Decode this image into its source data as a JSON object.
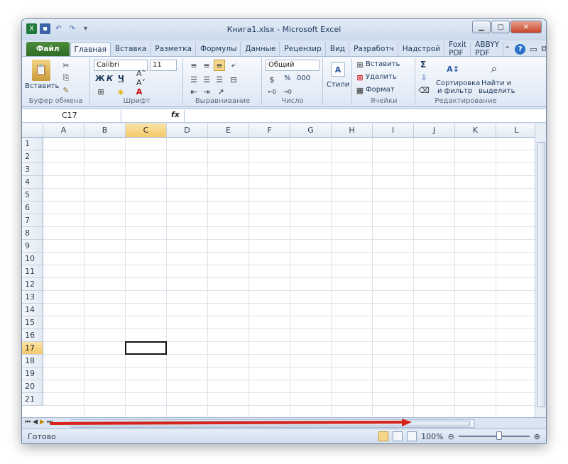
{
  "window": {
    "title": "Книга1.xlsx - Microsoft Excel"
  },
  "tabs": [
    "Файл",
    "Главная",
    "Вставка",
    "Разметка",
    "Формулы",
    "Данные",
    "Рецензир",
    "Вид",
    "Разработч",
    "Надстрой",
    "Foxit PDF",
    "ABBYY PDF"
  ],
  "ribbon": {
    "clipboard": {
      "paste": "Вставить",
      "label": "Буфер обмена"
    },
    "font": {
      "name": "Calibri",
      "size": "11",
      "label": "Шрифт",
      "bold": "Ж",
      "italic": "К",
      "underline": "Ч"
    },
    "alignment": {
      "label": "Выравнивание"
    },
    "number": {
      "format": "Общий",
      "label": "Число",
      "percent": "%",
      "thousands": "000"
    },
    "styles": {
      "label": "Стили"
    },
    "cells": {
      "insert": "Вставить",
      "delete": "Удалить",
      "format": "Формат",
      "label": "Ячейки"
    },
    "editing": {
      "sort": "Сортировка",
      "sort2": "и фильтр",
      "find": "Найти и",
      "find2": "выделить",
      "label": "Редактирование",
      "sum": "Σ"
    }
  },
  "formula_bar": {
    "name_box": "C17",
    "fx": "fx"
  },
  "grid": {
    "columns": [
      "A",
      "B",
      "C",
      "D",
      "E",
      "F",
      "G",
      "H",
      "I",
      "J",
      "K",
      "L"
    ],
    "rows": [
      "1",
      "2",
      "3",
      "4",
      "5",
      "6",
      "7",
      "8",
      "9",
      "10",
      "11",
      "12",
      "13",
      "14",
      "15",
      "16",
      "17",
      "18",
      "19",
      "20",
      "21"
    ],
    "selected_column": "C",
    "selected_row": "17"
  },
  "status": {
    "ready": "Готово",
    "zoom": "100%",
    "zoom_level_percent": 100
  },
  "colors": {
    "file_tab": "#2f6b25",
    "selection": "#f5c96a",
    "arrow": "#d8221c"
  }
}
